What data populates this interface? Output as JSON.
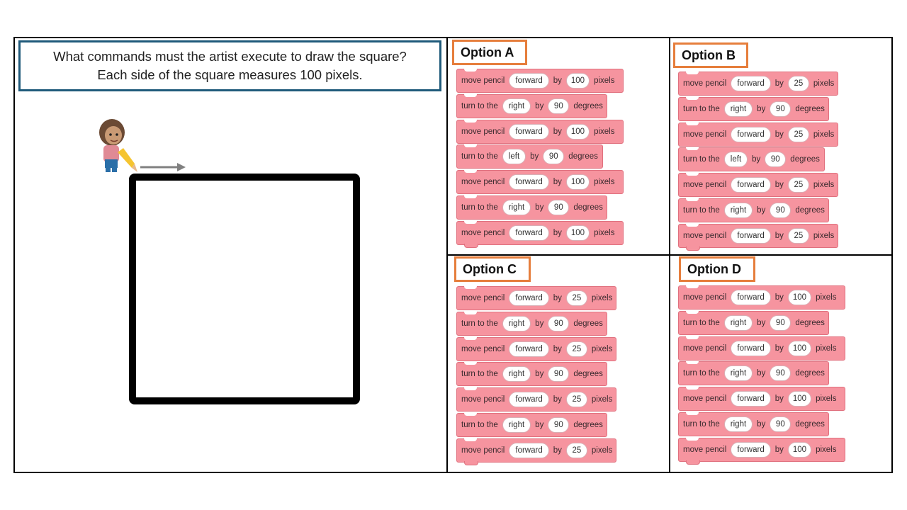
{
  "question": {
    "line1": "What commands must the artist execute to draw the square?",
    "line2": "Each side of the square measures 100 pixels."
  },
  "colors": {
    "block_fill": "#f6949f",
    "option_border": "#e67e3c",
    "question_border": "#1f5a7a",
    "square_stroke": "#000000",
    "arrow": "#808080"
  },
  "icons": {
    "artist": "artist-character-icon",
    "direction": "right-arrow-icon"
  },
  "words": {
    "move": "move pencil",
    "turn": "turn to the",
    "by": "by",
    "pixels": "pixels",
    "degrees": "degrees",
    "forward": "forward"
  },
  "options": [
    {
      "label": "Option A",
      "blocks": [
        {
          "kind": "move",
          "value": "100"
        },
        {
          "kind": "turn",
          "dir": "right",
          "value": "90"
        },
        {
          "kind": "move",
          "value": "100"
        },
        {
          "kind": "turn",
          "dir": "left",
          "value": "90"
        },
        {
          "kind": "move",
          "value": "100"
        },
        {
          "kind": "turn",
          "dir": "right",
          "value": "90"
        },
        {
          "kind": "move",
          "value": "100"
        }
      ]
    },
    {
      "label": "Option B",
      "blocks": [
        {
          "kind": "move",
          "value": "25"
        },
        {
          "kind": "turn",
          "dir": "right",
          "value": "90"
        },
        {
          "kind": "move",
          "value": "25"
        },
        {
          "kind": "turn",
          "dir": "left",
          "value": "90"
        },
        {
          "kind": "move",
          "value": "25"
        },
        {
          "kind": "turn",
          "dir": "right",
          "value": "90"
        },
        {
          "kind": "move",
          "value": "25"
        }
      ]
    },
    {
      "label": "Option C",
      "blocks": [
        {
          "kind": "move",
          "value": "25"
        },
        {
          "kind": "turn",
          "dir": "right",
          "value": "90"
        },
        {
          "kind": "move",
          "value": "25"
        },
        {
          "kind": "turn",
          "dir": "right",
          "value": "90"
        },
        {
          "kind": "move",
          "value": "25"
        },
        {
          "kind": "turn",
          "dir": "right",
          "value": "90"
        },
        {
          "kind": "move",
          "value": "25"
        }
      ]
    },
    {
      "label": "Option D",
      "blocks": [
        {
          "kind": "move",
          "value": "100"
        },
        {
          "kind": "turn",
          "dir": "right",
          "value": "90"
        },
        {
          "kind": "move",
          "value": "100"
        },
        {
          "kind": "turn",
          "dir": "right",
          "value": "90"
        },
        {
          "kind": "move",
          "value": "100"
        },
        {
          "kind": "turn",
          "dir": "right",
          "value": "90"
        },
        {
          "kind": "move",
          "value": "100"
        }
      ]
    }
  ]
}
